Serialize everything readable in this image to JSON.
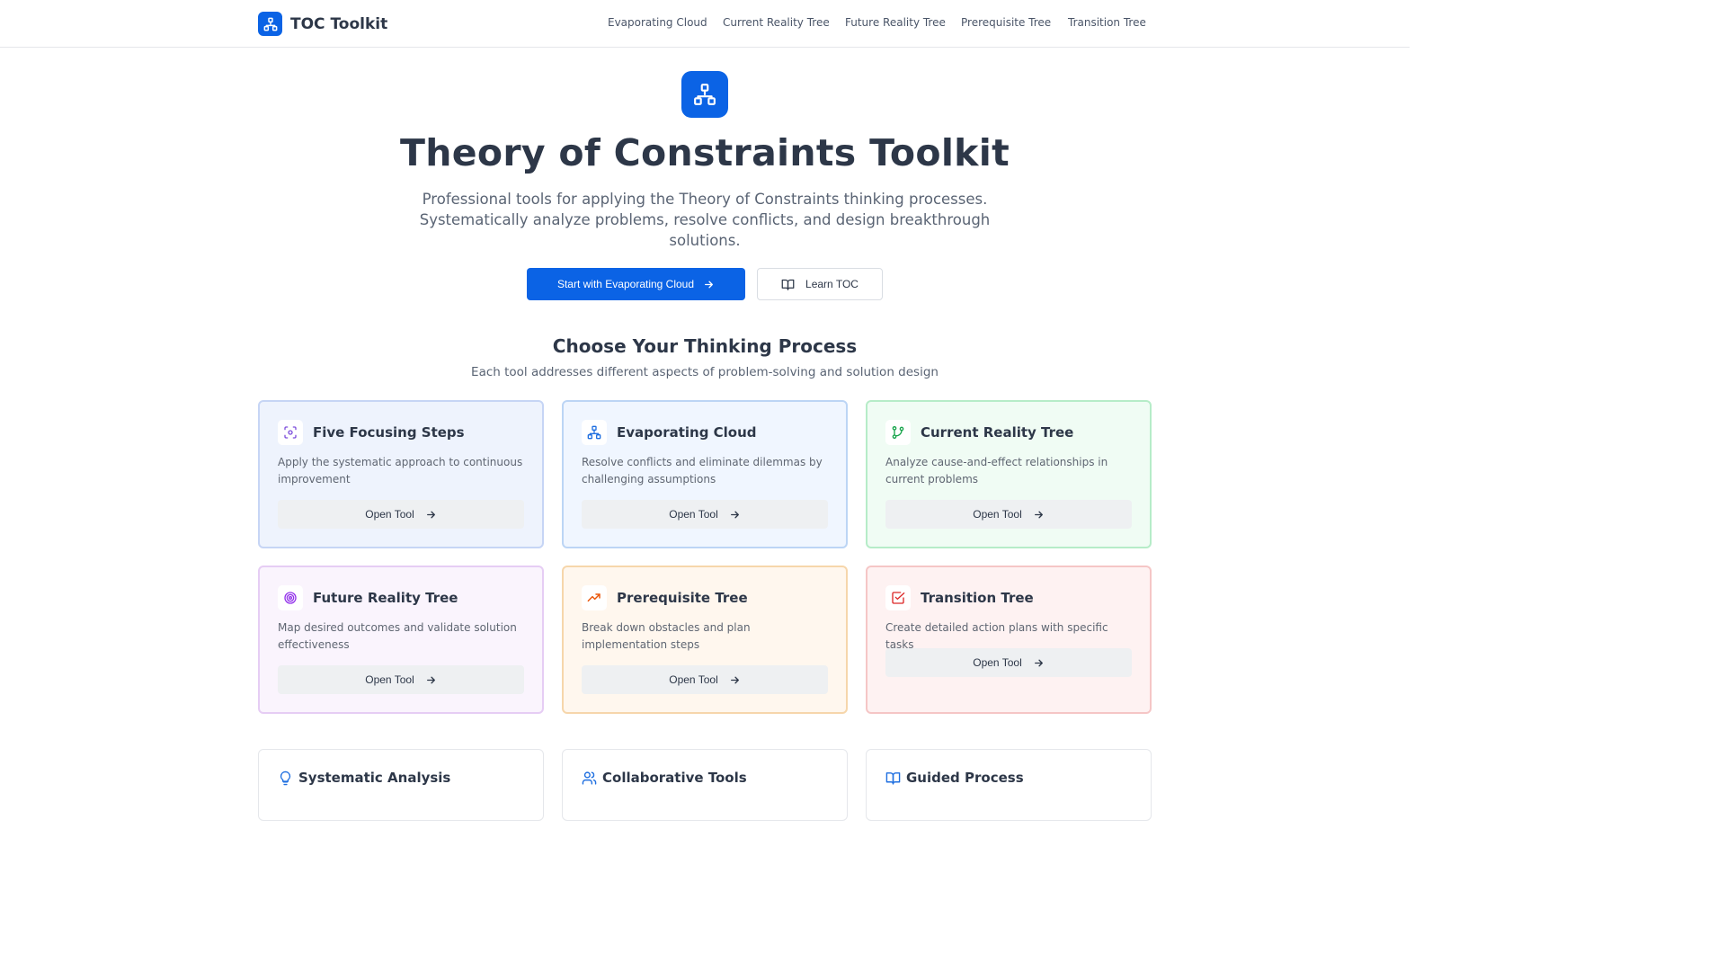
{
  "header": {
    "brand": "TOC Toolkit",
    "nav": [
      "Evaporating Cloud",
      "Current Reality Tree",
      "Future Reality Tree",
      "Prerequisite Tree",
      "Transition Tree"
    ]
  },
  "hero": {
    "title": "Theory of Constraints Toolkit",
    "subtitle": "Professional tools for applying the Theory of Constraints thinking processes. Systematically analyze problems, resolve conflicts, and design breakthrough solutions.",
    "primary_button": "Start with Evaporating Cloud",
    "secondary_button": "Learn TOC"
  },
  "section": {
    "title": "Choose Your Thinking Process",
    "subtitle": "Each tool addresses different aspects of problem-solving and solution design"
  },
  "tools": [
    {
      "title": "Five Focusing Steps",
      "description": "Apply the systematic approach to continuous improvement",
      "button": "Open Tool",
      "icon": "focus-icon",
      "accent": "#7c4ddb"
    },
    {
      "title": "Evaporating Cloud",
      "description": "Resolve conflicts and eliminate dilemmas by challenging assumptions",
      "button": "Open Tool",
      "icon": "network-icon",
      "accent": "#1f6fe0"
    },
    {
      "title": "Current Reality Tree",
      "description": "Analyze cause-and-effect relationships in current problems",
      "button": "Open Tool",
      "icon": "git-branch-icon",
      "accent": "#16a34a"
    },
    {
      "title": "Future Reality Tree",
      "description": "Map desired outcomes and validate solution effectiveness",
      "button": "Open Tool",
      "icon": "target-icon",
      "accent": "#9333ea"
    },
    {
      "title": "Prerequisite Tree",
      "description": "Break down obstacles and plan implementation steps",
      "button": "Open Tool",
      "icon": "trending-up-icon",
      "accent": "#ea580c"
    },
    {
      "title": "Transition Tree",
      "description": "Create detailed action plans with specific tasks",
      "button": "Open Tool",
      "icon": "checkbox-icon",
      "accent": "#dc2626"
    }
  ],
  "features": [
    {
      "title": "Systematic Analysis",
      "icon": "lightbulb-icon"
    },
    {
      "title": "Collaborative Tools",
      "icon": "users-icon"
    },
    {
      "title": "Guided Process",
      "icon": "book-open-icon"
    }
  ],
  "colors": {
    "primary": "#0b63e5",
    "text": "#2d3748",
    "muted": "#5a6474"
  }
}
